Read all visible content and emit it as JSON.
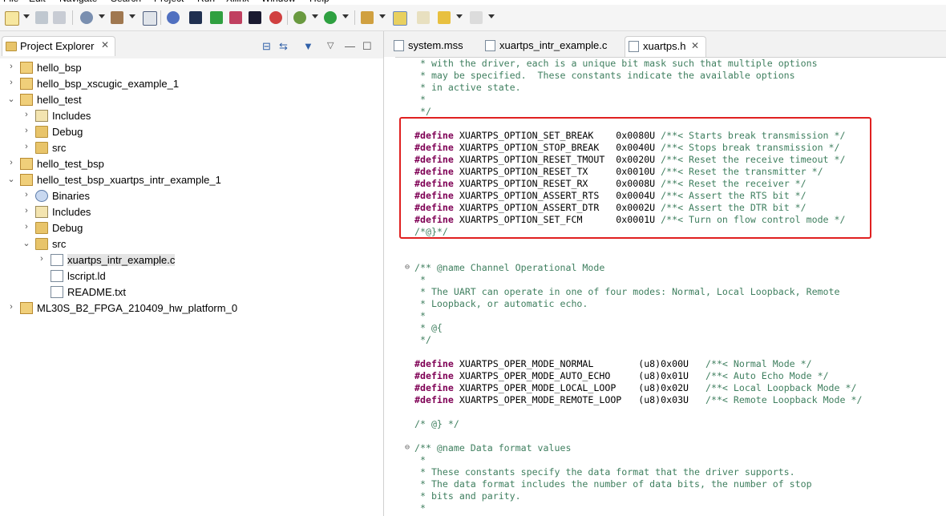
{
  "menu": [
    "File",
    "Edit",
    "Navigate",
    "Search",
    "Project",
    "Run",
    "Xilinx",
    "Window",
    "Help"
  ],
  "project_explorer": {
    "title": "Project Explorer",
    "close": "✕",
    "items": [
      {
        "label": "hello_bsp",
        "depth": 0,
        "twisty": "›",
        "icon": "bsp-project-icon"
      },
      {
        "label": "hello_bsp_xscugic_example_1",
        "depth": 0,
        "twisty": "›",
        "icon": "project-folder-icon"
      },
      {
        "label": "hello_test",
        "depth": 0,
        "twisty": "⌄",
        "icon": "project-folder-icon"
      },
      {
        "label": "Includes",
        "depth": 1,
        "twisty": "›",
        "icon": "includes-icon"
      },
      {
        "label": "Debug",
        "depth": 1,
        "twisty": "›",
        "icon": "folder-icon"
      },
      {
        "label": "src",
        "depth": 1,
        "twisty": "›",
        "icon": "folder-icon"
      },
      {
        "label": "hello_test_bsp",
        "depth": 0,
        "twisty": "›",
        "icon": "bsp-project-icon"
      },
      {
        "label": "hello_test_bsp_xuartps_intr_example_1",
        "depth": 0,
        "twisty": "⌄",
        "icon": "project-folder-icon"
      },
      {
        "label": "Binaries",
        "depth": 1,
        "twisty": "›",
        "icon": "binaries-icon"
      },
      {
        "label": "Includes",
        "depth": 1,
        "twisty": "›",
        "icon": "includes-icon"
      },
      {
        "label": "Debug",
        "depth": 1,
        "twisty": "›",
        "icon": "folder-icon"
      },
      {
        "label": "src",
        "depth": 1,
        "twisty": "⌄",
        "icon": "folder-open-icon"
      },
      {
        "label": "xuartps_intr_example.c",
        "depth": 2,
        "twisty": "›",
        "icon": "c-file-icon",
        "selected": true
      },
      {
        "label": "lscript.ld",
        "depth": 2,
        "twisty": "",
        "icon": "linker-script-icon"
      },
      {
        "label": "README.txt",
        "depth": 2,
        "twisty": "",
        "icon": "text-file-icon"
      },
      {
        "label": "ML30S_B2_FPGA_210409_hw_platform_0",
        "depth": 0,
        "twisty": "›",
        "icon": "hw-platform-icon"
      }
    ]
  },
  "editor": {
    "tabs": [
      {
        "label": "system.mss",
        "active": false,
        "icon": "mss-file-icon"
      },
      {
        "label": "xuartps_intr_example.c",
        "active": false,
        "icon": "c-file-icon"
      },
      {
        "label": "xuartps.h",
        "active": true,
        "icon": "h-file-icon",
        "close": "✕"
      }
    ],
    "lines": [
      {
        "kind": "comment",
        "text": " * with the driver, each is a unique bit mask such that multiple options"
      },
      {
        "kind": "comment",
        "text": " * may be specified.  These constants indicate the available options"
      },
      {
        "kind": "comment",
        "text": " * in active state."
      },
      {
        "kind": "comment",
        "text": " *"
      },
      {
        "kind": "comment",
        "text": " */"
      },
      {
        "kind": "blank",
        "text": ""
      },
      {
        "kind": "define",
        "name": "XUARTPS_OPTION_SET_BREAK    0x0080U ",
        "comment": "/**< Starts break transmission */"
      },
      {
        "kind": "define",
        "name": "XUARTPS_OPTION_STOP_BREAK   0x0040U ",
        "comment": "/**< Stops break transmission */"
      },
      {
        "kind": "define",
        "name": "XUARTPS_OPTION_RESET_TMOUT  0x0020U ",
        "comment": "/**< Reset the receive timeout */"
      },
      {
        "kind": "define",
        "name": "XUARTPS_OPTION_RESET_TX     0x0010U ",
        "comment": "/**< Reset the transmitter */"
      },
      {
        "kind": "define",
        "name": "XUARTPS_OPTION_RESET_RX     0x0008U ",
        "comment": "/**< Reset the receiver */"
      },
      {
        "kind": "define",
        "name": "XUARTPS_OPTION_ASSERT_RTS   0x0004U ",
        "comment": "/**< Assert the RTS bit */"
      },
      {
        "kind": "define",
        "name": "XUARTPS_OPTION_ASSERT_DTR   0x0002U ",
        "comment": "/**< Assert the DTR bit */"
      },
      {
        "kind": "define",
        "name": "XUARTPS_OPTION_SET_FCM      0x0001U ",
        "comment": "/**< Turn on flow control mode */"
      },
      {
        "kind": "comment",
        "text": "/*@}*/"
      },
      {
        "kind": "blank",
        "text": ""
      },
      {
        "kind": "blank",
        "text": ""
      },
      {
        "kind": "comment",
        "text": "/** @name Channel Operational Mode",
        "fold": "⊖"
      },
      {
        "kind": "comment",
        "text": " *"
      },
      {
        "kind": "comment",
        "text": " * The UART can operate in one of four modes: Normal, Local Loopback, Remote"
      },
      {
        "kind": "comment",
        "text": " * Loopback, or automatic echo."
      },
      {
        "kind": "comment",
        "text": " *"
      },
      {
        "kind": "comment",
        "text": " * @{"
      },
      {
        "kind": "comment",
        "text": " */"
      },
      {
        "kind": "blank",
        "text": ""
      },
      {
        "kind": "define",
        "name": "XUARTPS_OPER_MODE_NORMAL        (u8)0x00U   ",
        "comment": "/**< Normal Mode */"
      },
      {
        "kind": "define",
        "name": "XUARTPS_OPER_MODE_AUTO_ECHO     (u8)0x01U   ",
        "comment": "/**< Auto Echo Mode */"
      },
      {
        "kind": "define",
        "name": "XUARTPS_OPER_MODE_LOCAL_LOOP    (u8)0x02U   ",
        "comment": "/**< Local Loopback Mode */"
      },
      {
        "kind": "define",
        "name": "XUARTPS_OPER_MODE_REMOTE_LOOP   (u8)0x03U   ",
        "comment": "/**< Remote Loopback Mode */"
      },
      {
        "kind": "blank",
        "text": ""
      },
      {
        "kind": "comment",
        "text": "/* @} */"
      },
      {
        "kind": "blank",
        "text": ""
      },
      {
        "kind": "comment",
        "text": "/** @name Data format values",
        "fold": "⊖"
      },
      {
        "kind": "comment",
        "text": " *"
      },
      {
        "kind": "comment",
        "text": " * These constants specify the data format that the driver supports."
      },
      {
        "kind": "comment",
        "text": " * The data format includes the number of data bits, the number of stop"
      },
      {
        "kind": "comment",
        "text": " * bits and parity."
      },
      {
        "kind": "comment",
        "text": " *"
      }
    ],
    "define_keyword": "#define"
  },
  "colors": {
    "comment": "#3f7f5f",
    "keyword": "#7f0055",
    "highlight_box": "#e02020"
  }
}
